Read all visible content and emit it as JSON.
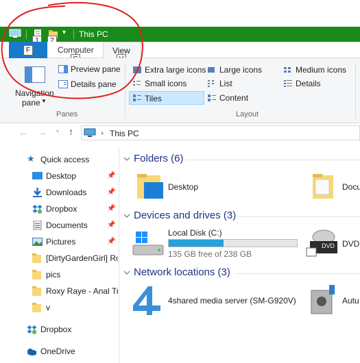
{
  "titlebar": {
    "title": "This PC"
  },
  "keytips": {
    "qa1": "1",
    "qa2": "2",
    "file": "F",
    "computer": "C",
    "view": "V"
  },
  "tabs": {
    "computer": "Computer",
    "view": "View"
  },
  "ribbon": {
    "panes": {
      "group_label": "Panes",
      "navigation_pane_line1": "Navigation",
      "navigation_pane_line2": "pane",
      "preview_pane": "Preview pane",
      "details_pane": "Details pane"
    },
    "layout": {
      "group_label": "Layout",
      "extra_large_icons": "Extra large icons",
      "large_icons": "Large icons",
      "medium_icons": "Medium icons",
      "small_icons": "Small icons",
      "list": "List",
      "details": "Details",
      "tiles": "Tiles",
      "content": "Content",
      "selected": "Tiles"
    }
  },
  "address": {
    "path": "This PC"
  },
  "nav": {
    "quick_access": "Quick access",
    "items": [
      {
        "label": "Desktop",
        "pinned": true,
        "icon": "desktop-icon"
      },
      {
        "label": "Downloads",
        "pinned": true,
        "icon": "download-icon"
      },
      {
        "label": "Dropbox",
        "pinned": true,
        "icon": "dropbox-icon"
      },
      {
        "label": "Documents",
        "pinned": true,
        "icon": "documents-icon"
      },
      {
        "label": "Pictures",
        "pinned": true,
        "icon": "pictures-icon"
      },
      {
        "label": "[DirtyGardenGirl] Ro",
        "pinned": false,
        "icon": "folder-icon"
      },
      {
        "label": "pics",
        "pinned": false,
        "icon": "folder-icon"
      },
      {
        "label": "Roxy Raye - Anal Tra",
        "pinned": false,
        "icon": "folder-icon"
      },
      {
        "label": "v",
        "pinned": false,
        "icon": "folder-icon"
      }
    ],
    "dropbox": "Dropbox",
    "onedrive": "OneDrive"
  },
  "main": {
    "folders": {
      "header": "Folders (6)",
      "items": [
        "Desktop",
        "Docu"
      ]
    },
    "drives": {
      "header": "Devices and drives (3)",
      "local_disk": {
        "name": "Local Disk (C:)",
        "free": "135 GB free of 238 GB",
        "used_fraction": 0.43
      },
      "dvd": "DVD"
    },
    "network": {
      "header": "Network locations (3)",
      "media_server": "4shared media server (SM-G920V)",
      "other": "Autu"
    }
  },
  "colors": {
    "titlebar": "#1a8a1a",
    "file_tab": "#1979ca",
    "header_text": "#1e3287",
    "annotation": "#e0201c",
    "bar": "#26a0da"
  }
}
